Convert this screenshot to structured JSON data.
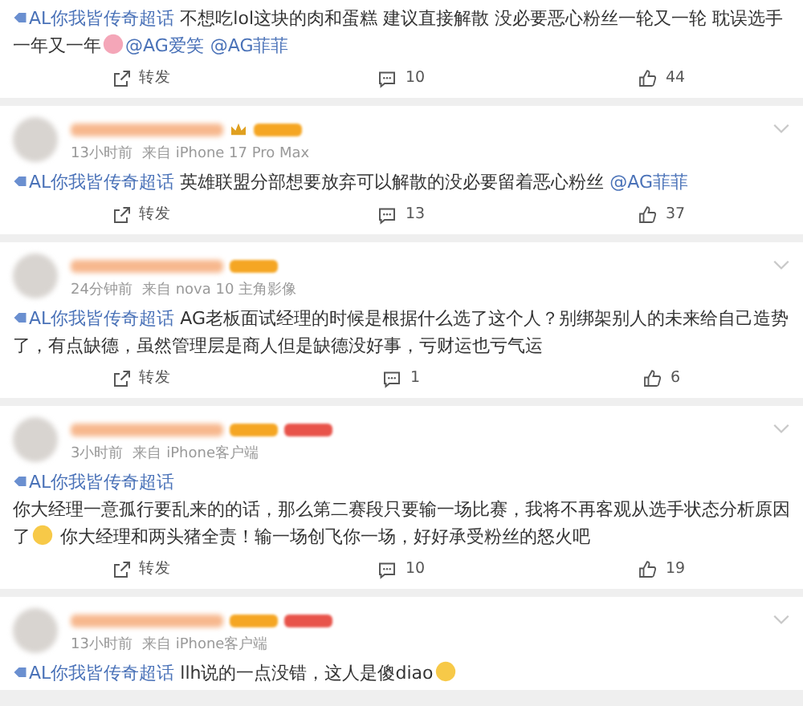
{
  "posts": [
    {
      "content": [
        {
          "kind": "topic",
          "text": "AL你我皆传奇超话"
        },
        {
          "kind": "text",
          "text": " 不想吃lol这块的肉和蛋糕 建议直接解散 没必要恶心粉丝一轮又一轮 耽误选手一年又一年"
        },
        {
          "kind": "emoji",
          "color": "#f4a6b8"
        },
        {
          "kind": "mention",
          "text": "@AG爱笑"
        },
        {
          "kind": "mention",
          "text": "@AG菲菲"
        }
      ],
      "repost": "转发",
      "comments": "10",
      "likes": "44"
    },
    {
      "header": {
        "time": "13小时前",
        "source": "来自 iPhone 17 Pro Max",
        "badges": [
          {
            "kind": "crown"
          },
          {
            "kind": "tag",
            "color": "#f5a623"
          }
        ]
      },
      "content": [
        {
          "kind": "topic",
          "text": "AL你我皆传奇超话"
        },
        {
          "kind": "text",
          "text": "  英雄联盟分部想要放弃可以解散的没必要留着恶心粉丝 "
        },
        {
          "kind": "mention",
          "text": "@AG菲菲"
        }
      ],
      "repost": "转发",
      "comments": "13",
      "likes": "37"
    },
    {
      "header": {
        "time": "24分钟前",
        "source": "来自 nova 10 主角影像",
        "badges": [
          {
            "kind": "tag",
            "color": "#f5a623"
          }
        ]
      },
      "content": [
        {
          "kind": "topic",
          "text": "AL你我皆传奇超话"
        },
        {
          "kind": "text",
          "text": " AG老板面试经理的时候是根据什么选了这个人？别绑架别人的未来给自己造势了，有点缺德，虽然管理层是商人但是缺德没好事，亏财运也亏气运"
        }
      ],
      "repost": "转发",
      "comments": "1",
      "likes": "6"
    },
    {
      "header": {
        "time": "3小时前",
        "source": "来自 iPhone客户端",
        "badges": [
          {
            "kind": "tag",
            "color": "#f5a623"
          },
          {
            "kind": "tag",
            "color": "#e8534a"
          }
        ]
      },
      "content": [
        {
          "kind": "topic",
          "text": "AL你我皆传奇超话"
        },
        {
          "kind": "break"
        },
        {
          "kind": "text",
          "text": "你大经理一意孤行要乱来的的话，那么第二赛段只要输一场比赛，我将不再客观从选手状态分析原因了"
        },
        {
          "kind": "emoji",
          "color": "#f7c948"
        },
        {
          "kind": "text",
          "text": " 你大经理和两头猪全责！输一场创飞你一场，好好承受粉丝的怒火吧"
        }
      ],
      "repost": "转发",
      "comments": "10",
      "likes": "19"
    },
    {
      "header": {
        "time": "13小时前",
        "source": "来自 iPhone客户端",
        "badges": [
          {
            "kind": "tag",
            "color": "#f5a623"
          },
          {
            "kind": "tag",
            "color": "#e8534a"
          }
        ]
      },
      "content": [
        {
          "kind": "topic",
          "text": "AL你我皆传奇超话"
        },
        {
          "kind": "text",
          "text": " llh说的一点没错，这人是傻diao"
        },
        {
          "kind": "emoji",
          "color": "#f7c948"
        }
      ]
    }
  ]
}
